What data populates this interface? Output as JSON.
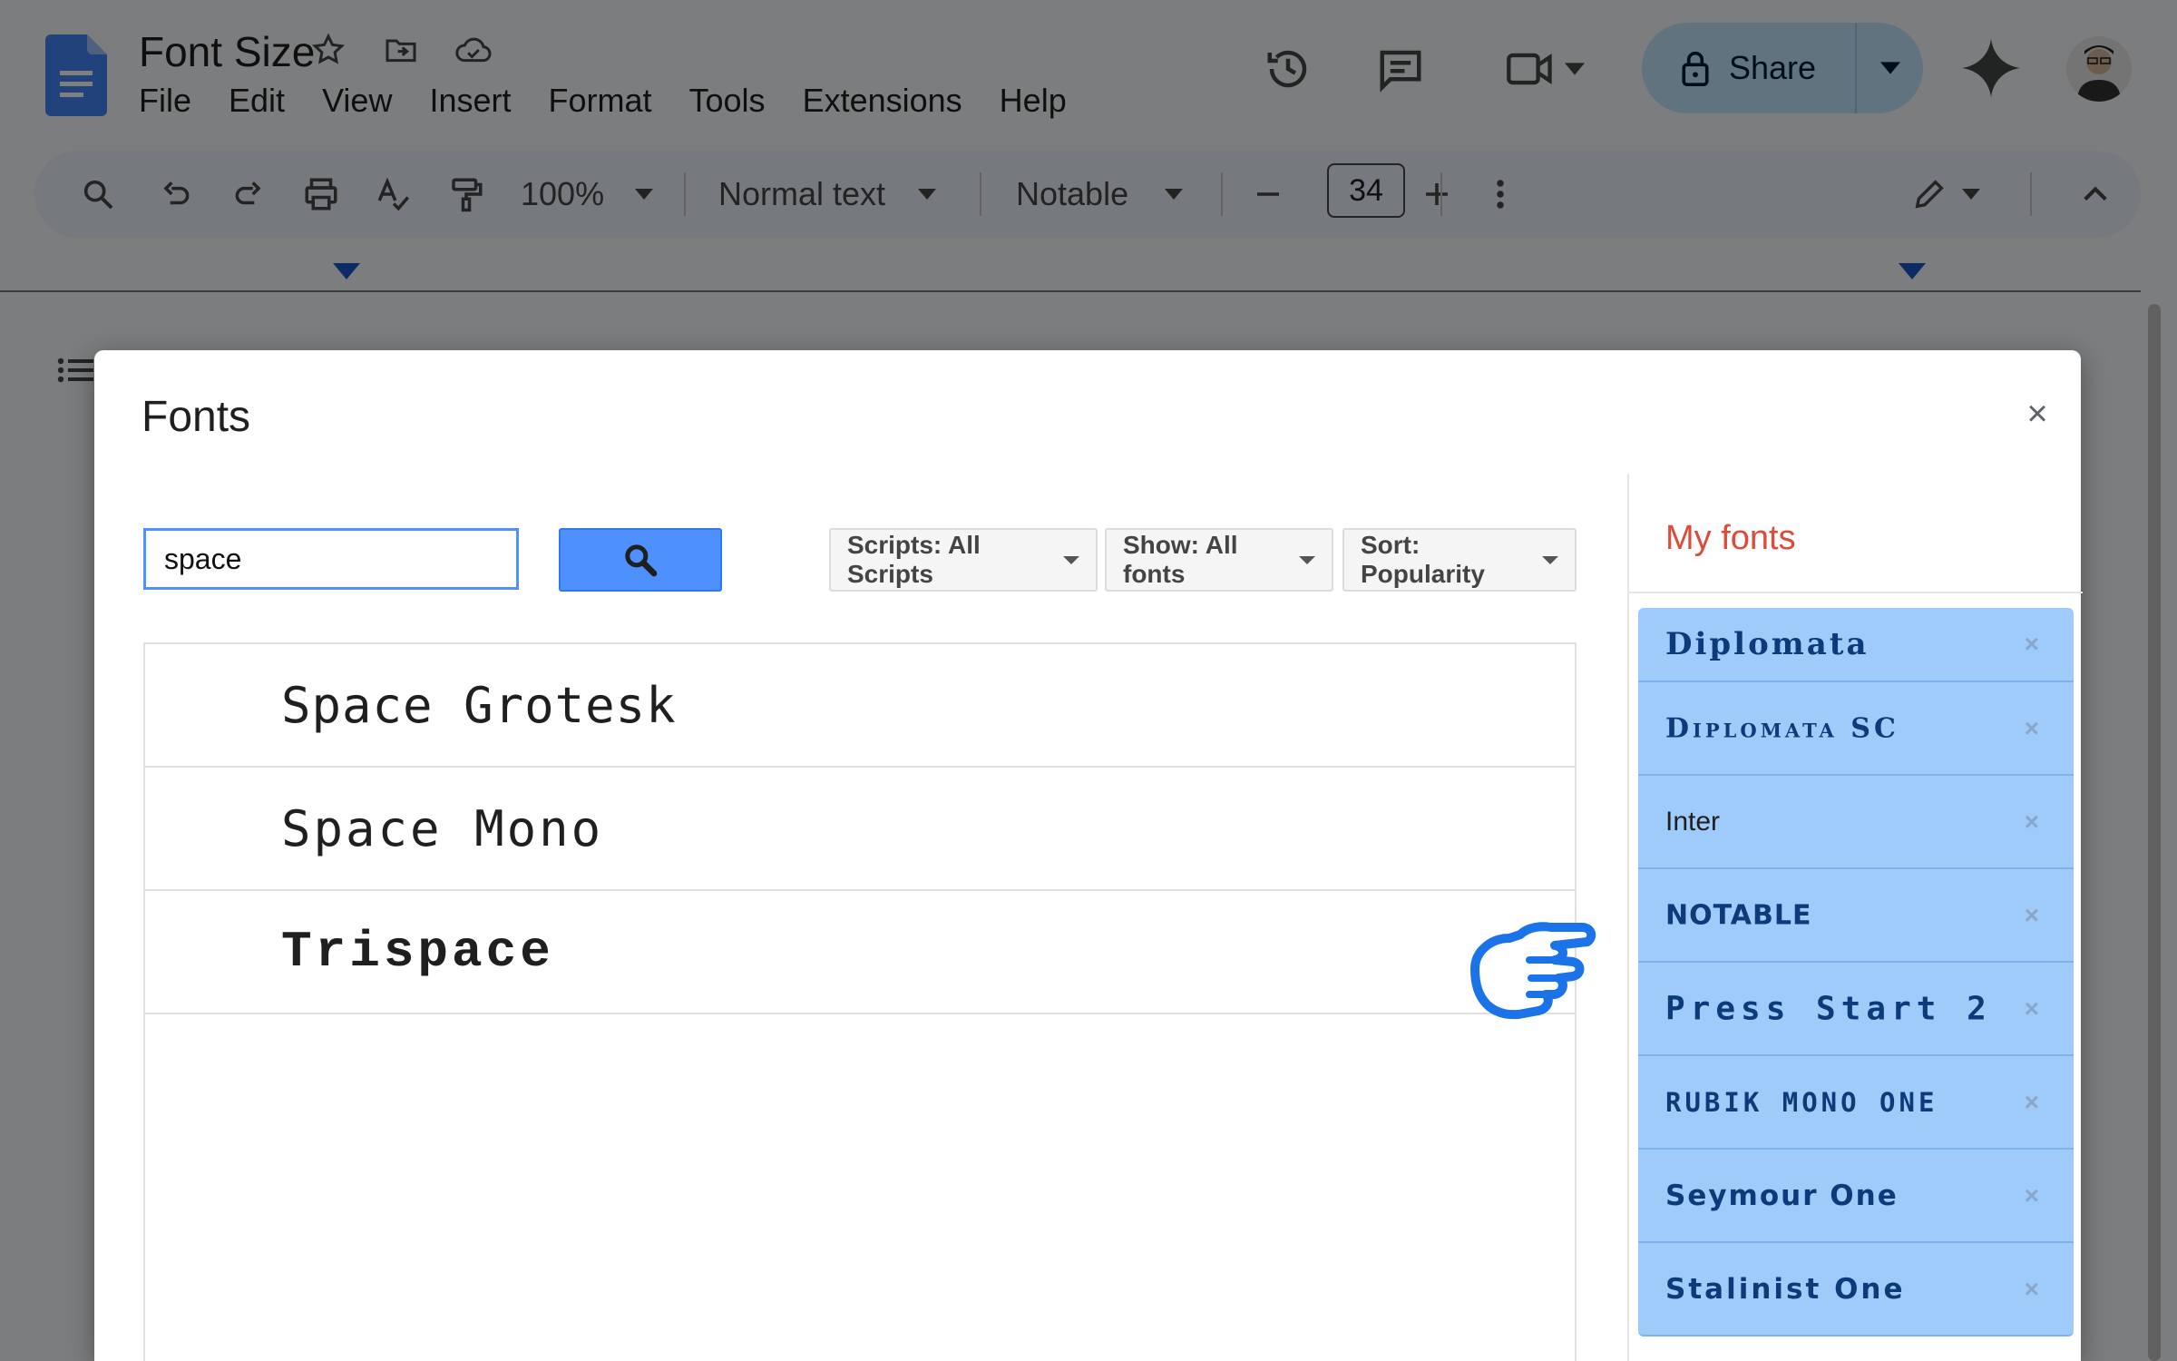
{
  "document": {
    "title": "Font Size",
    "menu": [
      "File",
      "Edit",
      "View",
      "Insert",
      "Format",
      "Tools",
      "Extensions",
      "Help"
    ],
    "share_label": "Share"
  },
  "toolbar": {
    "zoom": "100%",
    "style": "Normal text",
    "font": "Notable",
    "font_size": "34"
  },
  "dialog": {
    "title": "Fonts",
    "close_label": "×",
    "search": {
      "value": "space"
    },
    "filters": {
      "scripts": "Scripts: All Scripts",
      "show": "Show: All fonts",
      "sort": "Sort: Popularity"
    },
    "results": [
      "Space Grotesk",
      "Space Mono",
      "Trispace"
    ],
    "my_fonts": {
      "title": "My fonts",
      "items": [
        "Diplomata",
        "Diplomata SC",
        "Inter",
        "NOTABLE",
        "Press Start 2P",
        "RUBIK MONO ONE",
        "Seymour One",
        "Stalinist One"
      ],
      "remove_label": "×"
    }
  },
  "colors": {
    "accent_blue": "#4d90fe",
    "my_fonts_title": "#dd4b39",
    "my_fonts_item_bg": "#9fcbfb",
    "share_bg": "#c2e7ff"
  }
}
